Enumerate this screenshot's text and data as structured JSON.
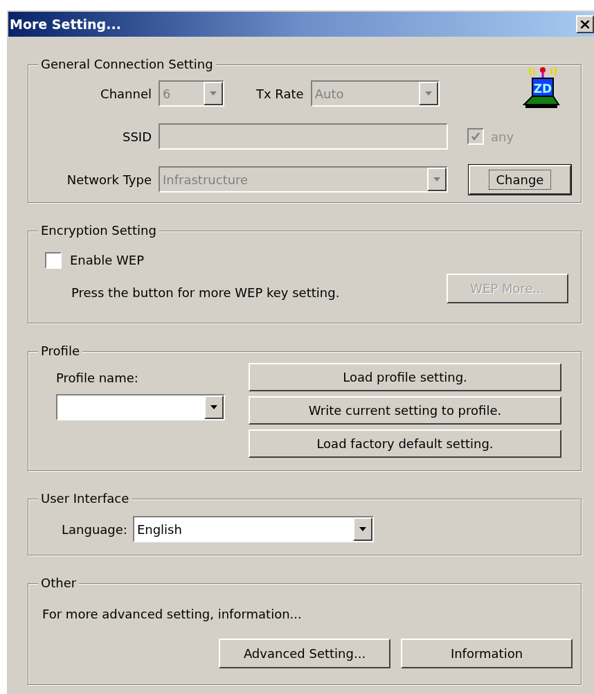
{
  "window": {
    "title": "More Setting...",
    "close": "×"
  },
  "general": {
    "title": "General Connection Setting",
    "channel": {
      "label": "Channel",
      "value": "6",
      "disabled": true
    },
    "tx_rate": {
      "label": "Tx Rate",
      "value": "Auto",
      "disabled": true
    },
    "ssid": {
      "label": "SSID",
      "disabled": true
    },
    "any": {
      "label": "any",
      "checked": true,
      "disabled": true
    },
    "network_type": {
      "label": "Network Type",
      "value": "Infrastructure",
      "disabled": true
    },
    "logo_text": "ZD",
    "change_button": {
      "label": "Change",
      "focused": true
    }
  },
  "encryption": {
    "title": "Encryption Setting",
    "enable_wep": {
      "label": "Enable WEP",
      "checked": false
    },
    "note": "Press the button for more WEP key setting.",
    "wep_more_button": {
      "label": "WEP More...",
      "disabled": true
    }
  },
  "profile": {
    "title": "Profile",
    "name_label": "Profile name:",
    "buttons": [
      "Load profile setting.",
      "Write current setting to profile.",
      "Load factory default setting."
    ]
  },
  "user_interface": {
    "title": "User Interface",
    "language_label": "Language:",
    "language_value": "English"
  },
  "other": {
    "title": "Other",
    "note": "For more advanced setting, information...",
    "buttons": [
      "Advanced Setting...",
      "Information"
    ]
  }
}
